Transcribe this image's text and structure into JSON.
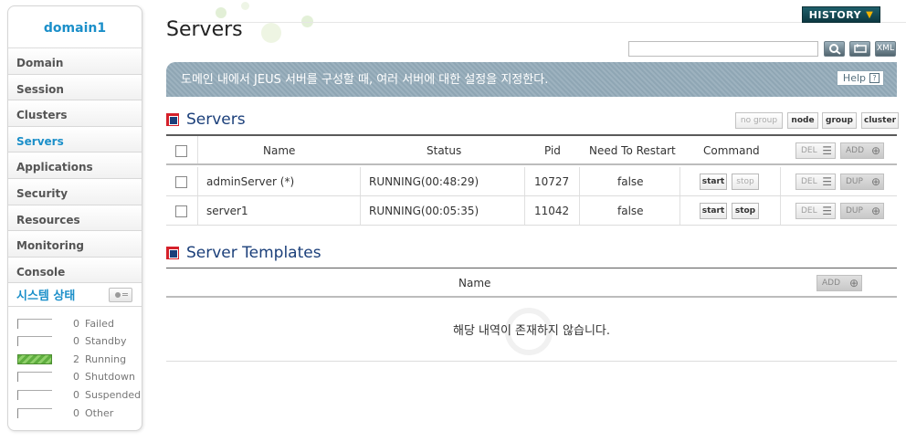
{
  "sidebar": {
    "domain": "domain1",
    "items": [
      {
        "label": "Domain"
      },
      {
        "label": "Session"
      },
      {
        "label": "Clusters"
      },
      {
        "label": "Servers"
      },
      {
        "label": "Applications"
      },
      {
        "label": "Security"
      },
      {
        "label": "Resources"
      },
      {
        "label": "Monitoring"
      },
      {
        "label": "Console"
      }
    ],
    "active_item": "Servers",
    "system_status": {
      "title": "시스템 상태",
      "rows": [
        {
          "count": "0",
          "label": "Failed"
        },
        {
          "count": "0",
          "label": "Standby"
        },
        {
          "count": "2",
          "label": "Running"
        },
        {
          "count": "0",
          "label": "Shutdown"
        },
        {
          "count": "0",
          "label": "Suspended"
        },
        {
          "count": "0",
          "label": "Other"
        }
      ]
    }
  },
  "header": {
    "title": "Servers",
    "history_label": "HISTORY",
    "search_value": "",
    "xml_label": "XML"
  },
  "banner": {
    "text": "도메인 내에서 JEUS 서버를 구성할 때, 여러 서버에 대한 설정을 지정한다.",
    "help_label": "Help",
    "help_icon": "?"
  },
  "servers_section": {
    "title": "Servers",
    "view_buttons": [
      "no group",
      "node",
      "group",
      "cluster"
    ],
    "columns": [
      "Name",
      "Status",
      "Pid",
      "Need To Restart",
      "Command"
    ],
    "del_label": "DEL",
    "add_label": "ADD",
    "dup_label": "DUP",
    "start_label": "start",
    "stop_label": "stop",
    "rows": [
      {
        "name": "adminServer (*)",
        "status": "RUNNING(00:48:29)",
        "pid": "10727",
        "need_restart": "false"
      },
      {
        "name": "server1",
        "status": "RUNNING(00:05:35)",
        "pid": "11042",
        "need_restart": "false"
      }
    ]
  },
  "templates_section": {
    "title": "Server Templates",
    "column_name": "Name",
    "add_label": "ADD",
    "empty_message": "해당 내역이 존재하지 않습니다."
  },
  "colors": {
    "accent_blue": "#1b8fc9",
    "heading_navy": "#1b3f7a",
    "heading_red": "#d5202a",
    "banner": "#8fa6b4",
    "running_green": "#5fae3f"
  }
}
